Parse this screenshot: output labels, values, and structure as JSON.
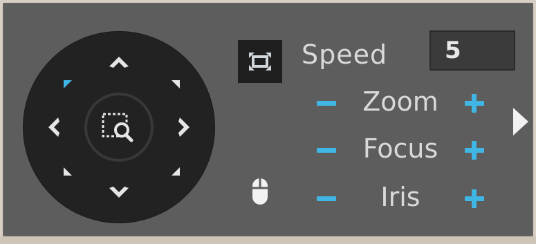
{
  "ptz": {
    "directions": [
      "up",
      "down",
      "left",
      "right",
      "up-left",
      "up-right",
      "down-left",
      "down-right"
    ],
    "active_direction": "up-left",
    "center_icon": "zoom-region-icon",
    "colors": {
      "pad": "#222222",
      "arrow": "#e6e6e6",
      "active": "#3fb6e4"
    }
  },
  "fullscreen": {
    "icon": "fullscreen-icon"
  },
  "speed": {
    "label": "Speed",
    "value": "5"
  },
  "controls": [
    {
      "name": "Zoom",
      "minus_icon": "minus-icon",
      "plus_icon": "plus-icon"
    },
    {
      "name": "Focus",
      "minus_icon": "minus-icon",
      "plus_icon": "plus-icon"
    },
    {
      "name": "Iris",
      "minus_icon": "minus-icon",
      "plus_icon": "plus-icon"
    }
  ],
  "mouse": {
    "icon": "mouse-icon"
  },
  "expand": {
    "icon": "chevron-right-icon"
  },
  "accent_color": "#3fb6e4",
  "panel_color": "#5d5d5d"
}
